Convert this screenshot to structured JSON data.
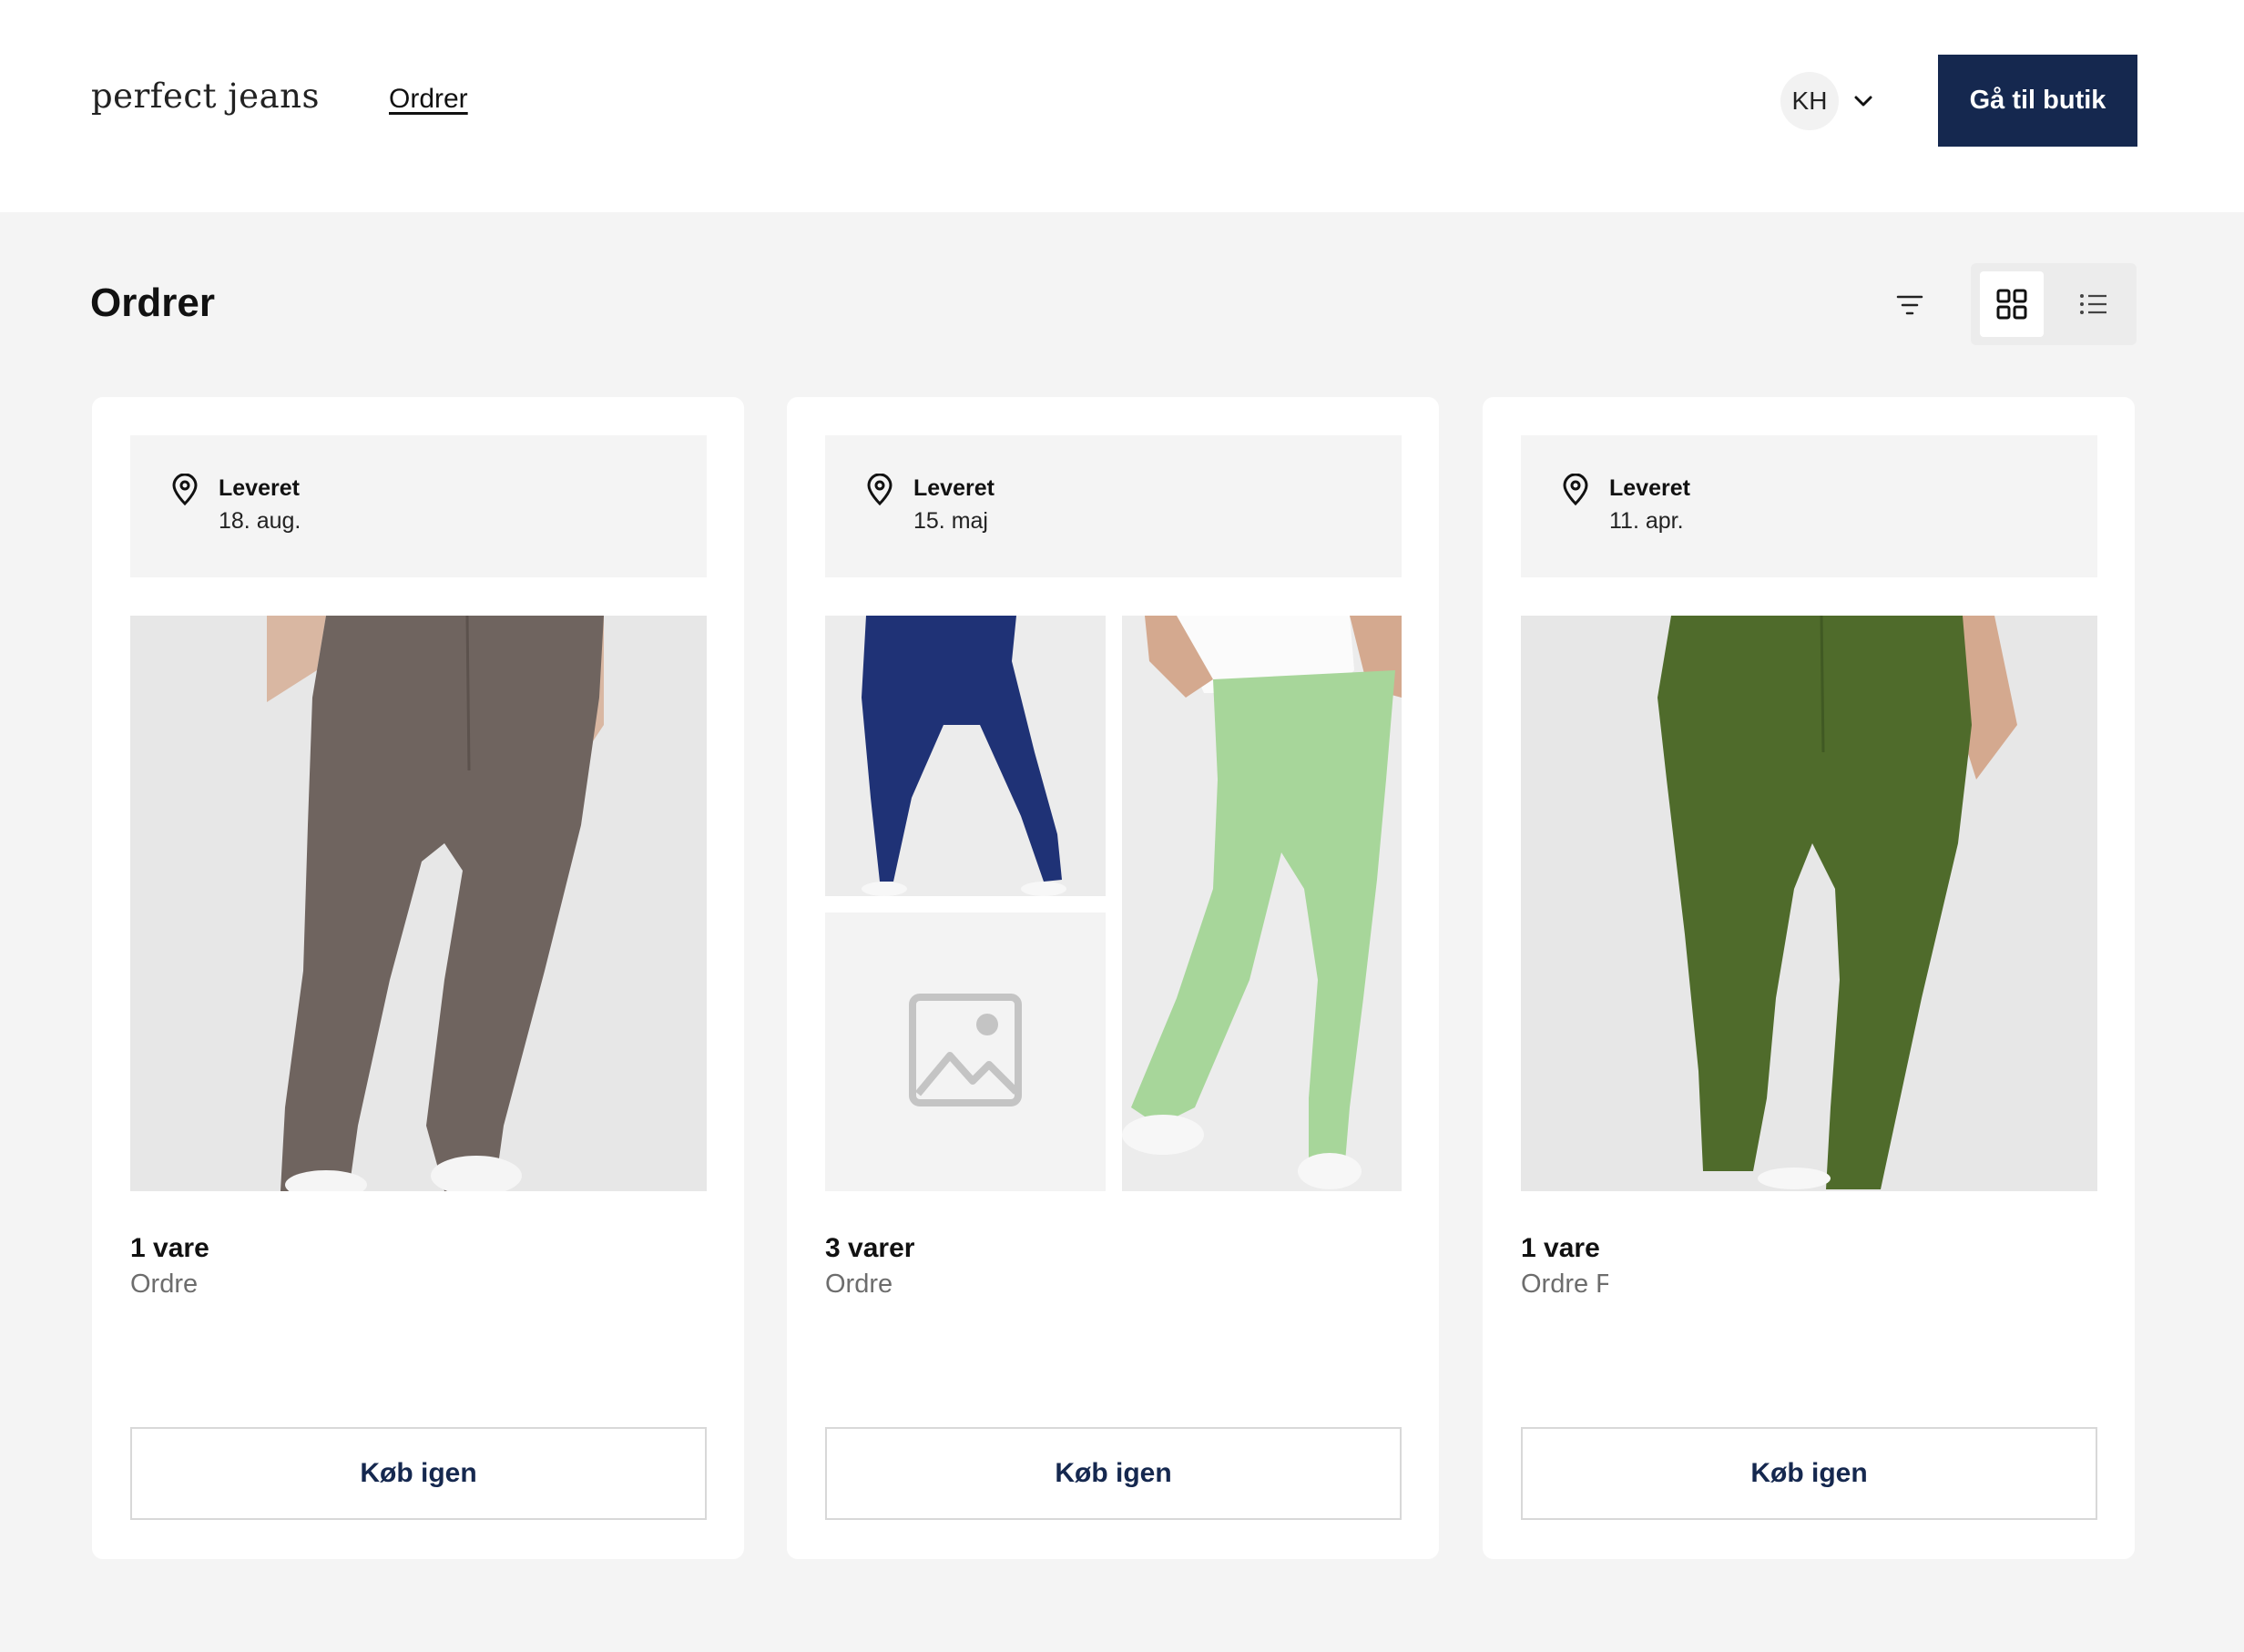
{
  "header": {
    "logo": "perfect jeans",
    "nav_orders": "Ordrer",
    "account_initials": "KH",
    "go_to_store": "Gå til butik"
  },
  "main": {
    "title": "Ordrer"
  },
  "colors": {
    "brand_navy": "#15284f",
    "page_bg": "#f4f4f4",
    "card_bg": "#ffffff"
  },
  "icons": {
    "chevron": "chevron-down-icon",
    "filter": "filter-icon",
    "grid": "grid-view-icon",
    "list": "list-view-icon",
    "pin": "map-pin-icon",
    "placeholder": "image-placeholder-icon"
  },
  "orders": [
    {
      "status": "Leveret",
      "date": "18. aug.",
      "count": "1 vare",
      "order_label": "Ordre",
      "button": "Køb igen"
    },
    {
      "status": "Leveret",
      "date": "15. maj",
      "count": "3 varer",
      "order_label": "Ordre",
      "button": "Køb igen"
    },
    {
      "status": "Leveret",
      "date": "11. apr.",
      "count": "1 vare",
      "order_label": "Ordre F",
      "button": "Køb igen"
    }
  ]
}
